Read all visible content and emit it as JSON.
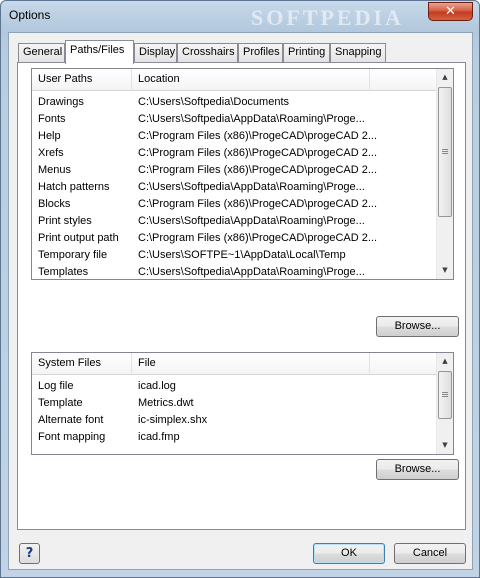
{
  "window": {
    "title": "Options",
    "watermark": "SOFTPEDIA",
    "close_glyph": "✕"
  },
  "tabs": [
    {
      "label": "General",
      "active": false
    },
    {
      "label": "Paths/Files",
      "active": true
    },
    {
      "label": "Display",
      "active": false
    },
    {
      "label": "Crosshairs",
      "active": false
    },
    {
      "label": "Profiles",
      "active": false
    },
    {
      "label": "Printing",
      "active": false
    },
    {
      "label": "Snapping",
      "active": false
    }
  ],
  "user_paths": {
    "headers": [
      "User Paths",
      "Location"
    ],
    "rows": [
      [
        "Drawings",
        "C:\\Users\\Softpedia\\Documents"
      ],
      [
        "Fonts",
        "C:\\Users\\Softpedia\\AppData\\Roaming\\Proge..."
      ],
      [
        "Help",
        "C:\\Program Files (x86)\\ProgeCAD\\progeCAD 2..."
      ],
      [
        "Xrefs",
        "C:\\Program Files (x86)\\ProgeCAD\\progeCAD 2..."
      ],
      [
        "Menus",
        "C:\\Program Files (x86)\\ProgeCAD\\progeCAD 2..."
      ],
      [
        "Hatch patterns",
        "C:\\Users\\Softpedia\\AppData\\Roaming\\Proge..."
      ],
      [
        "Blocks",
        "C:\\Program Files (x86)\\ProgeCAD\\progeCAD 2..."
      ],
      [
        "Print styles",
        "C:\\Users\\Softpedia\\AppData\\Roaming\\Proge..."
      ],
      [
        "Print output path",
        "C:\\Program Files (x86)\\ProgeCAD\\progeCAD 2..."
      ],
      [
        "Temporary file",
        "C:\\Users\\SOFTPE~1\\AppData\\Local\\Temp"
      ],
      [
        "Templates",
        "C:\\Users\\Softpedia\\AppData\\Roaming\\Proge..."
      ]
    ]
  },
  "system_files": {
    "headers": [
      "System Files",
      "File"
    ],
    "rows": [
      [
        "Log file",
        "icad.log"
      ],
      [
        "Template",
        "Metrics.dwt"
      ],
      [
        "Alternate font",
        "ic-simplex.shx"
      ],
      [
        "Font mapping",
        "icad.fmp"
      ]
    ]
  },
  "buttons": {
    "browse": "Browse...",
    "ok": "OK",
    "cancel": "Cancel",
    "help": "?"
  }
}
